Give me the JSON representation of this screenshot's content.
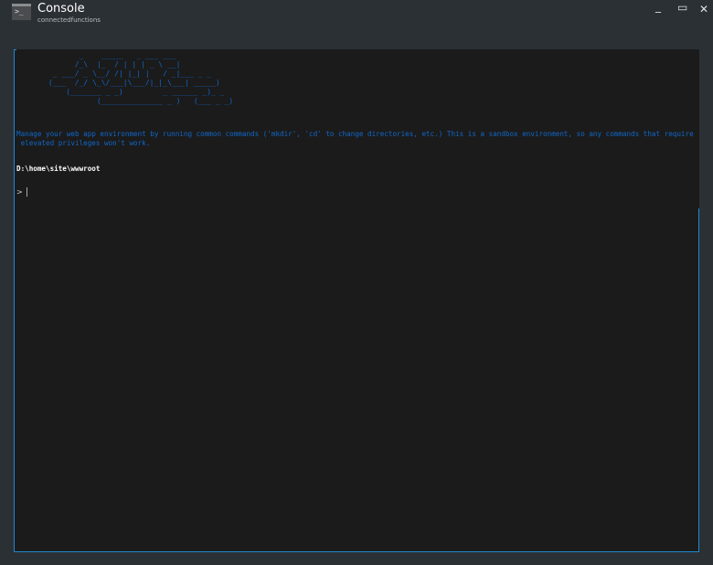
{
  "window": {
    "title": "Console",
    "subtitle": "connectedfunctions",
    "icon": "terminal-icon",
    "minimize": "_",
    "maximize": "▭",
    "close": "✕"
  },
  "console": {
    "ascii_art": "             _    _____   _ ___ ___\n            /_\\  |_  / | | | _ \\ __|\n       _ ___/ _ \\__/ /| |_| |   / _|___ _ _\n      (___  /_/ \\_\\/___|\\___/|_|_\\___| _____)\n          (_______ _ _)         _ ______ _)_ _\n                 (______________ _ )   (___ _ _)",
    "message": "Manage your web app environment by running common commands ('mkdir', 'cd' to change directories, etc.) This is a sandbox environment, so any commands that require\n elevated privileges won't work.",
    "cwd": "D:\\home\\site\\wwwroot",
    "prompt": ">",
    "accent": "#1c8bd0",
    "text_color": "#1167c9"
  }
}
